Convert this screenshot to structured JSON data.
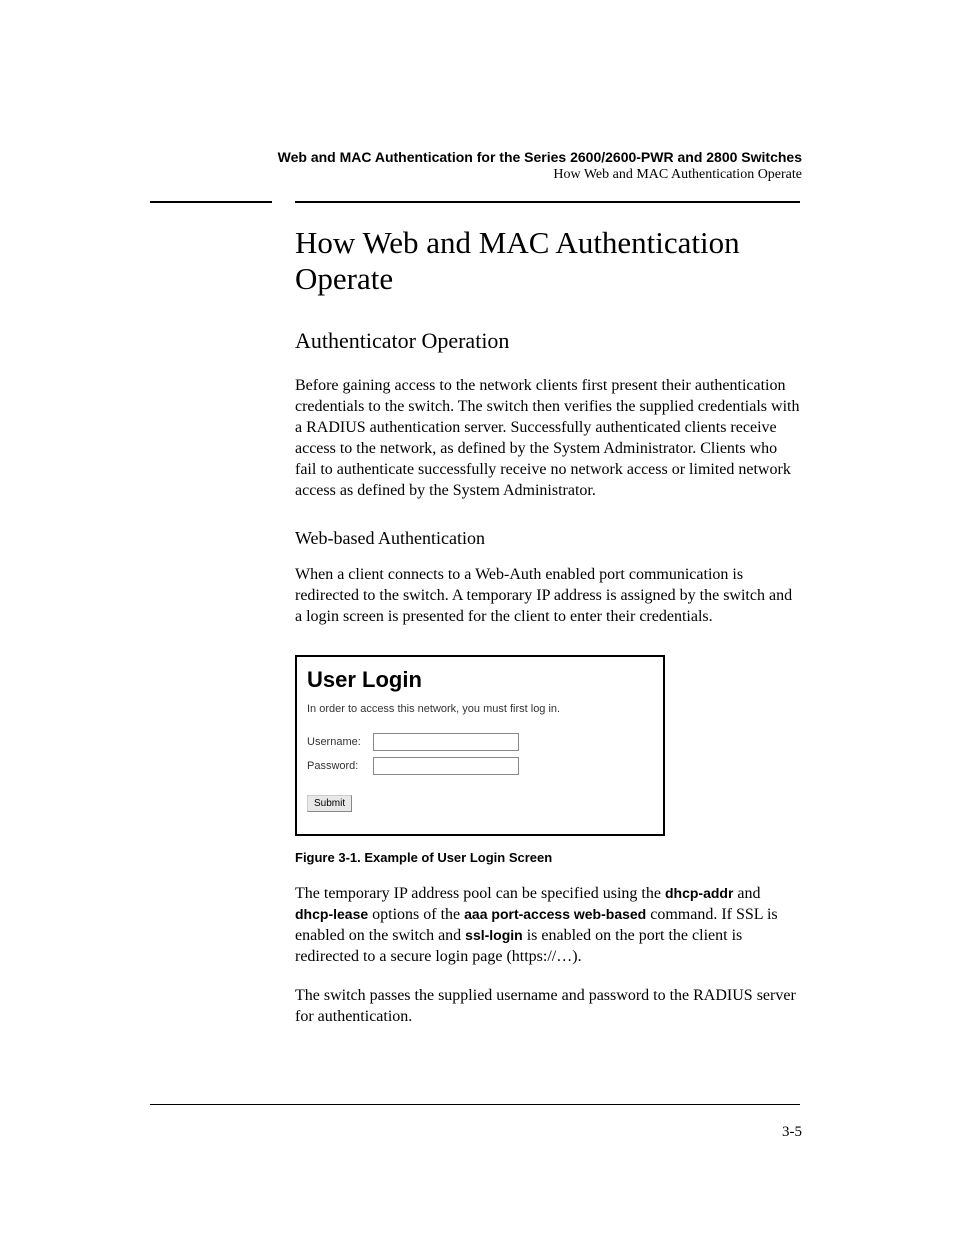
{
  "header": {
    "chapter_title": "Web and MAC Authentication for the Series 2600/2600-PWR and 2800 Switches",
    "section_title": "How Web and MAC Authentication Operate"
  },
  "main": {
    "h1": "How Web and MAC Authentication Operate",
    "h2": "Authenticator Operation",
    "p1": "Before gaining access to the network clients first present their authentication credentials to the switch. The switch then verifies the supplied credentials with a RADIUS authentication server. Successfully authenticated clients receive access to the network, as defined by the System Administrator. Clients who fail to authenticate successfully receive no network access or limited network access as defined by the System Administrator.",
    "h3": "Web-based Authentication",
    "p2": "When a client connects to a Web-Auth enabled port communication is redirected to the switch.   A temporary IP address is assigned by the switch and a login screen is presented for the client to enter their credentials.",
    "figure": {
      "title": "User Login",
      "subtitle": "In order to access this network, you must first log in.",
      "username_label": "Username:",
      "password_label": "Password:",
      "submit_label": "Submit",
      "caption": "Figure 3-1. Example of User Login Screen"
    },
    "p3_pre": "The temporary IP address pool can be specified using the ",
    "p3_b1": "dhcp-addr",
    "p3_mid1": " and ",
    "p3_b2": "dhcp-lease",
    "p3_mid2": " options of the ",
    "p3_b3": "aaa port-access web-based",
    "p3_mid3": " command. If SSL is enabled on the switch and ",
    "p3_b4": "ssl-login",
    "p3_post": " is enabled on the port the client is redirected to a secure login page (https://…).",
    "p4": "The switch passes the supplied username and password to the RADIUS server for authentication."
  },
  "footer": {
    "page_number": "3-5"
  }
}
